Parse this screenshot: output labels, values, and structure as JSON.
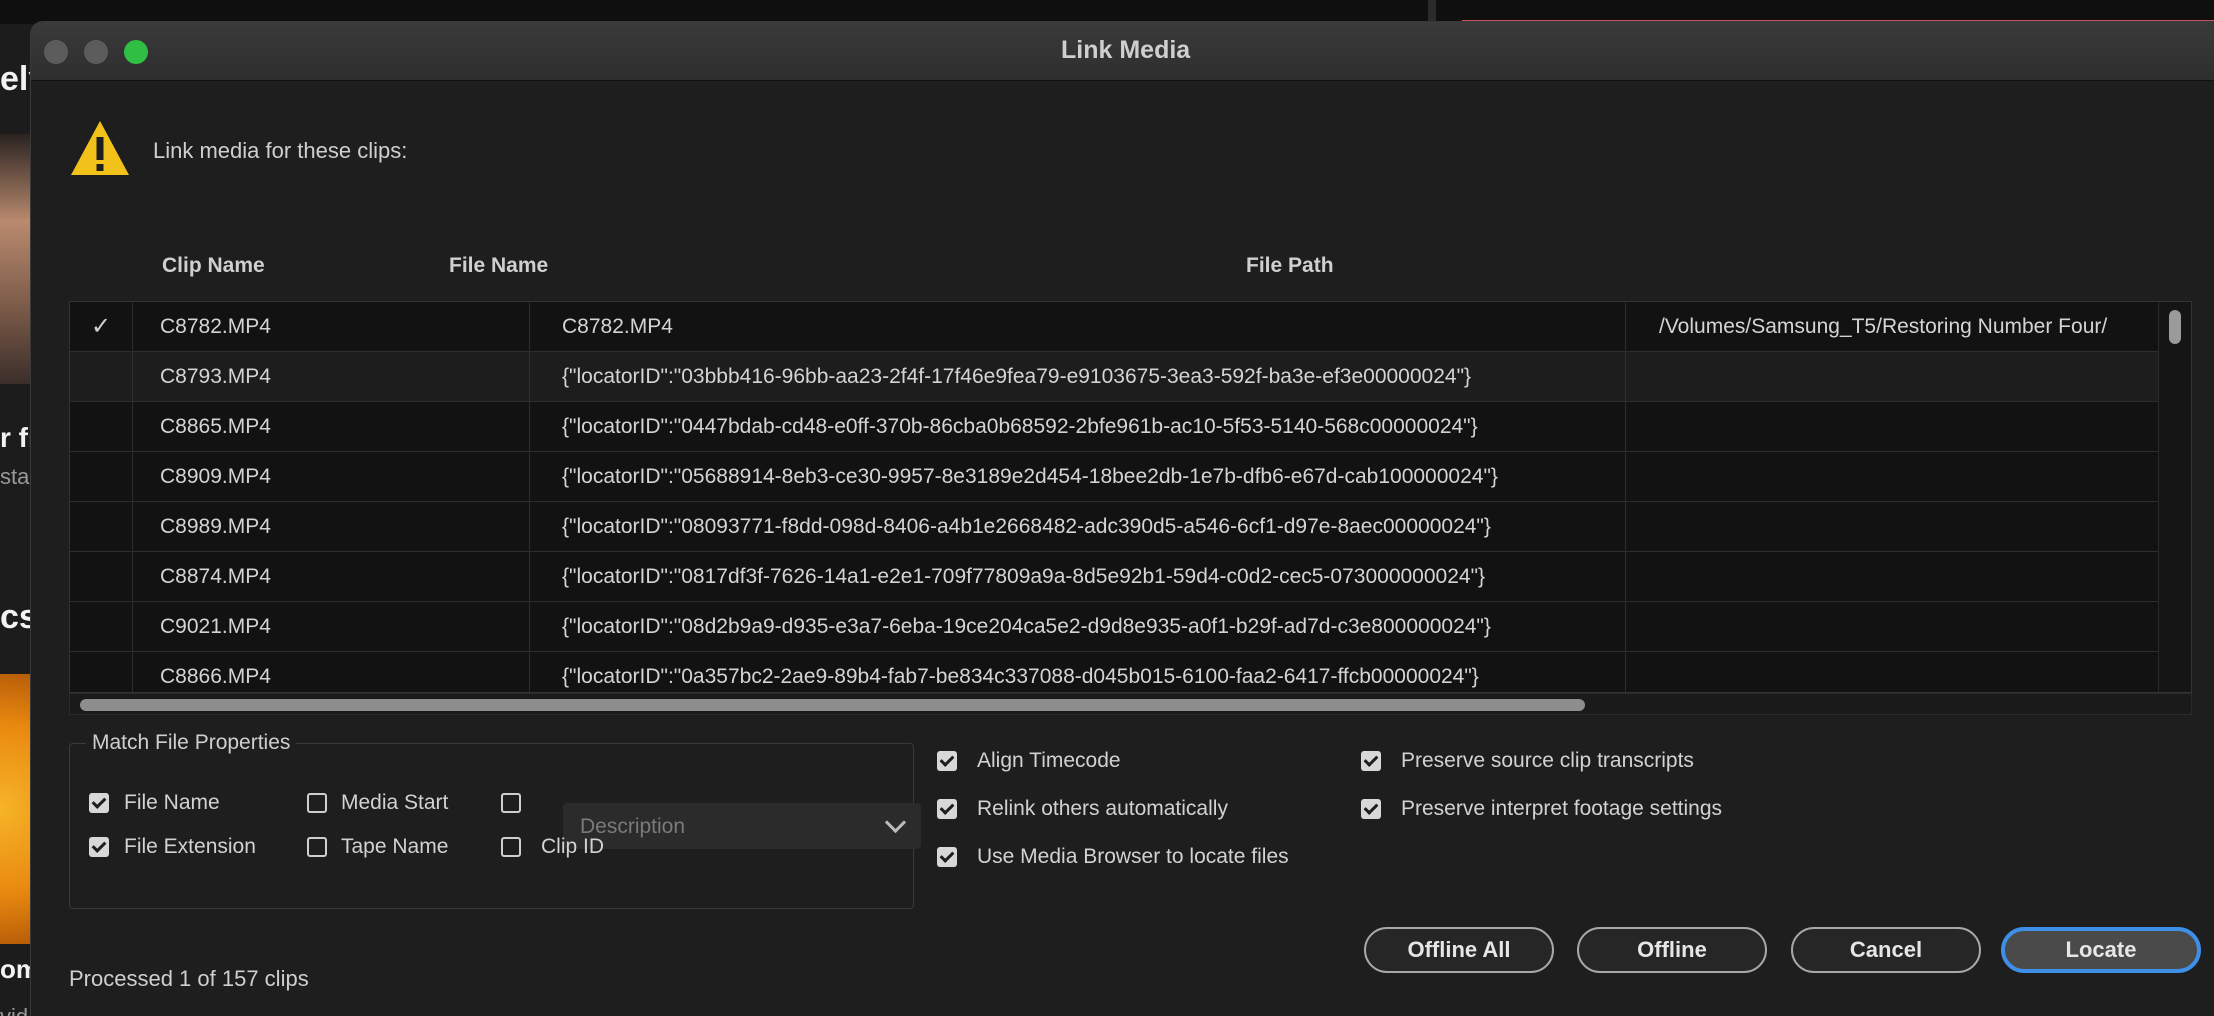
{
  "background": {
    "header_fragment": "ely",
    "line_fragment_1": "r fi",
    "line_fragment_2": "sta",
    "line_fragment_3": "cs",
    "line_fragment_4": "om",
    "line_fragment_5": "vid"
  },
  "dialog": {
    "title": "Link Media",
    "prompt": "Link media for these clips:",
    "warning_color": "#f2c21b"
  },
  "table": {
    "columns": [
      "Clip Name",
      "File Name",
      "File Path"
    ],
    "rows": [
      {
        "check": "✓",
        "clip": "C8782.MP4",
        "file": "C8782.MP4",
        "path": "/Volumes/Samsung_T5/Restoring Number Four/"
      },
      {
        "check": "",
        "clip": "C8793.MP4",
        "file": "{\"locatorID\":\"03bbb416-96bb-aa23-2f4f-17f46e9fea79-e9103675-3ea3-592f-ba3e-ef3e00000024\"}",
        "path": ""
      },
      {
        "check": "",
        "clip": "C8865.MP4",
        "file": "{\"locatorID\":\"0447bdab-cd48-e0ff-370b-86cba0b68592-2bfe961b-ac10-5f53-5140-568c00000024\"}",
        "path": ""
      },
      {
        "check": "",
        "clip": "C8909.MP4",
        "file": "{\"locatorID\":\"05688914-8eb3-ce30-9957-8e3189e2d454-18bee2db-1e7b-dfb6-e67d-cab100000024\"}",
        "path": ""
      },
      {
        "check": "",
        "clip": "C8989.MP4",
        "file": "{\"locatorID\":\"08093771-f8dd-098d-8406-a4b1e2668482-adc390d5-a546-6cf1-d97e-8aec00000024\"}",
        "path": ""
      },
      {
        "check": "",
        "clip": "C8874.MP4",
        "file": "{\"locatorID\":\"0817df3f-7626-14a1-e2e1-709f77809a9a-8d5e92b1-59d4-c0d2-cec5-073000000024\"}",
        "path": ""
      },
      {
        "check": "",
        "clip": "C9021.MP4",
        "file": "{\"locatorID\":\"08d2b9a9-d935-e3a7-6eba-19ce204ca5e2-d9d8e935-a0f1-b29f-ad7d-c3e800000024\"}",
        "path": ""
      },
      {
        "check": "",
        "clip": "C8866.MP4",
        "file": "{\"locatorID\":\"0a357bc2-2ae9-89b4-fab7-be834c337088-d045b015-6100-faa2-6417-ffcb00000024\"}",
        "path": ""
      }
    ]
  },
  "match_props": {
    "legend": "Match File Properties",
    "file_name": {
      "label": "File Name",
      "checked": true
    },
    "file_extension": {
      "label": "File Extension",
      "checked": true
    },
    "media_start": {
      "label": "Media Start",
      "checked": false
    },
    "tape_name": {
      "label": "Tape Name",
      "checked": false
    },
    "description": {
      "checked": false,
      "placeholder": "Description"
    },
    "clip_id": {
      "label": "Clip ID",
      "checked": false
    }
  },
  "options": {
    "align_timecode": "Align Timecode",
    "relink_others": "Relink others automatically",
    "use_media_browser": "Use Media Browser to locate files",
    "preserve_transcripts": "Preserve source clip transcripts",
    "preserve_interpret": "Preserve interpret footage settings"
  },
  "footer": {
    "status": "Processed 1 of 157 clips",
    "offline_all": "Offline All",
    "offline": "Offline",
    "cancel": "Cancel",
    "locate": "Locate"
  }
}
